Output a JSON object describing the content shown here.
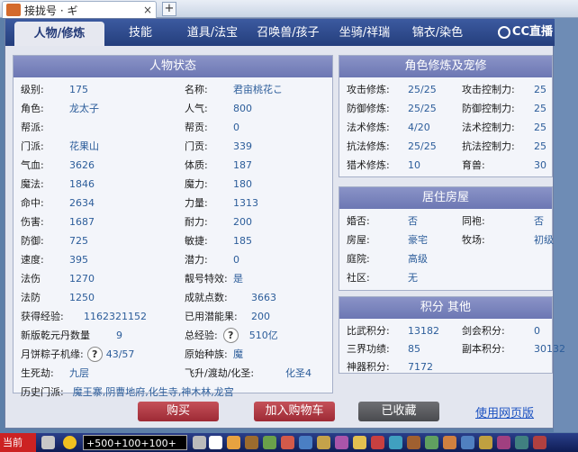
{
  "browser": {
    "tab_title": "接拢号 · ギ",
    "close": "×",
    "new_tab": "+"
  },
  "nav": {
    "tabs": [
      "人物/修炼",
      "技能",
      "道具/法宝",
      "召唤兽/孩子",
      "坐骑/祥瑞",
      "锦衣/染色"
    ],
    "logo": "CC直播"
  },
  "char_panel": {
    "title": "人物状态",
    "left": [
      {
        "label": "级别:",
        "value": "175"
      },
      {
        "label": "角色:",
        "value": "龙太子"
      },
      {
        "label": "帮派:",
        "value": ""
      },
      {
        "label": "门派:",
        "value": "花果山"
      },
      {
        "label": "气血:",
        "value": "3626"
      },
      {
        "label": "魔法:",
        "value": "1846"
      },
      {
        "label": "命中:",
        "value": "2634"
      },
      {
        "label": "伤害:",
        "value": "1687"
      },
      {
        "label": "防御:",
        "value": "725"
      },
      {
        "label": "速度:",
        "value": "395"
      },
      {
        "label": "法伤",
        "value": "1270"
      },
      {
        "label": "法防",
        "value": "1250"
      },
      {
        "label": "获得经验:",
        "value": "1162321152"
      },
      {
        "label": "新版乾元丹数量",
        "value": "9"
      },
      {
        "label": "月饼粽子机缘:",
        "value": "43/57"
      },
      {
        "label": "生死劫:",
        "value": "九层"
      }
    ],
    "right": [
      {
        "label": "名称:",
        "value": "君亩桃花こ"
      },
      {
        "label": "人气:",
        "value": "800"
      },
      {
        "label": "帮贡:",
        "value": "0"
      },
      {
        "label": "门贡:",
        "value": "339"
      },
      {
        "label": "体质:",
        "value": "187"
      },
      {
        "label": "魔力:",
        "value": "180"
      },
      {
        "label": "力量:",
        "value": "1313"
      },
      {
        "label": "耐力:",
        "value": "200"
      },
      {
        "label": "敏捷:",
        "value": "185"
      },
      {
        "label": "潜力:",
        "value": "0"
      },
      {
        "label": "靓号特效:",
        "value": "是"
      },
      {
        "label": "成就点数:",
        "value": "3663"
      },
      {
        "label": "已用潜能果:",
        "value": "200"
      },
      {
        "label": "总经验:",
        "value": "510亿"
      },
      {
        "label": "原始种族:",
        "value": "魔"
      },
      {
        "label": "飞升/渡劫/化圣:",
        "value": "化圣4"
      }
    ],
    "history_label": "历史门派:",
    "history_value": "魔王寨,阴曹地府,化生寺,神木林,龙宫"
  },
  "cultivation_panel": {
    "title": "角色修炼及宠修",
    "rows": [
      [
        "攻击修炼:",
        "25/25",
        "攻击控制力:",
        "25"
      ],
      [
        "防御修炼:",
        "25/25",
        "防御控制力:",
        "25"
      ],
      [
        "法术修炼:",
        "4/20",
        "法术控制力:",
        "25"
      ],
      [
        "抗法修炼:",
        "25/25",
        "抗法控制力:",
        "25"
      ],
      [
        "猎术修炼:",
        "10",
        "育兽:",
        "30"
      ]
    ]
  },
  "house_panel": {
    "title": "居住房屋",
    "rows": [
      [
        "婚否:",
        "否",
        "同袍:",
        "否"
      ],
      [
        "房屋:",
        "豪宅",
        "牧场:",
        "初级"
      ],
      [
        "庭院:",
        "高级",
        "",
        ""
      ],
      [
        "社区:",
        "无",
        "",
        ""
      ]
    ]
  },
  "score_panel": {
    "title": "积分 其他",
    "rows": [
      [
        "比武积分:",
        "13182",
        "剑会积分:",
        "0"
      ],
      [
        "三界功绩:",
        "85",
        "副本积分:",
        "30132"
      ],
      [
        "神器积分:",
        "7172",
        "",
        ""
      ]
    ]
  },
  "buttons": {
    "buy": "购买",
    "cart": "加入购物车",
    "collected": "已收藏",
    "web": "使用网页版"
  },
  "help": "?",
  "taskbar": {
    "start": "当前",
    "input": "+500+100+100+"
  }
}
